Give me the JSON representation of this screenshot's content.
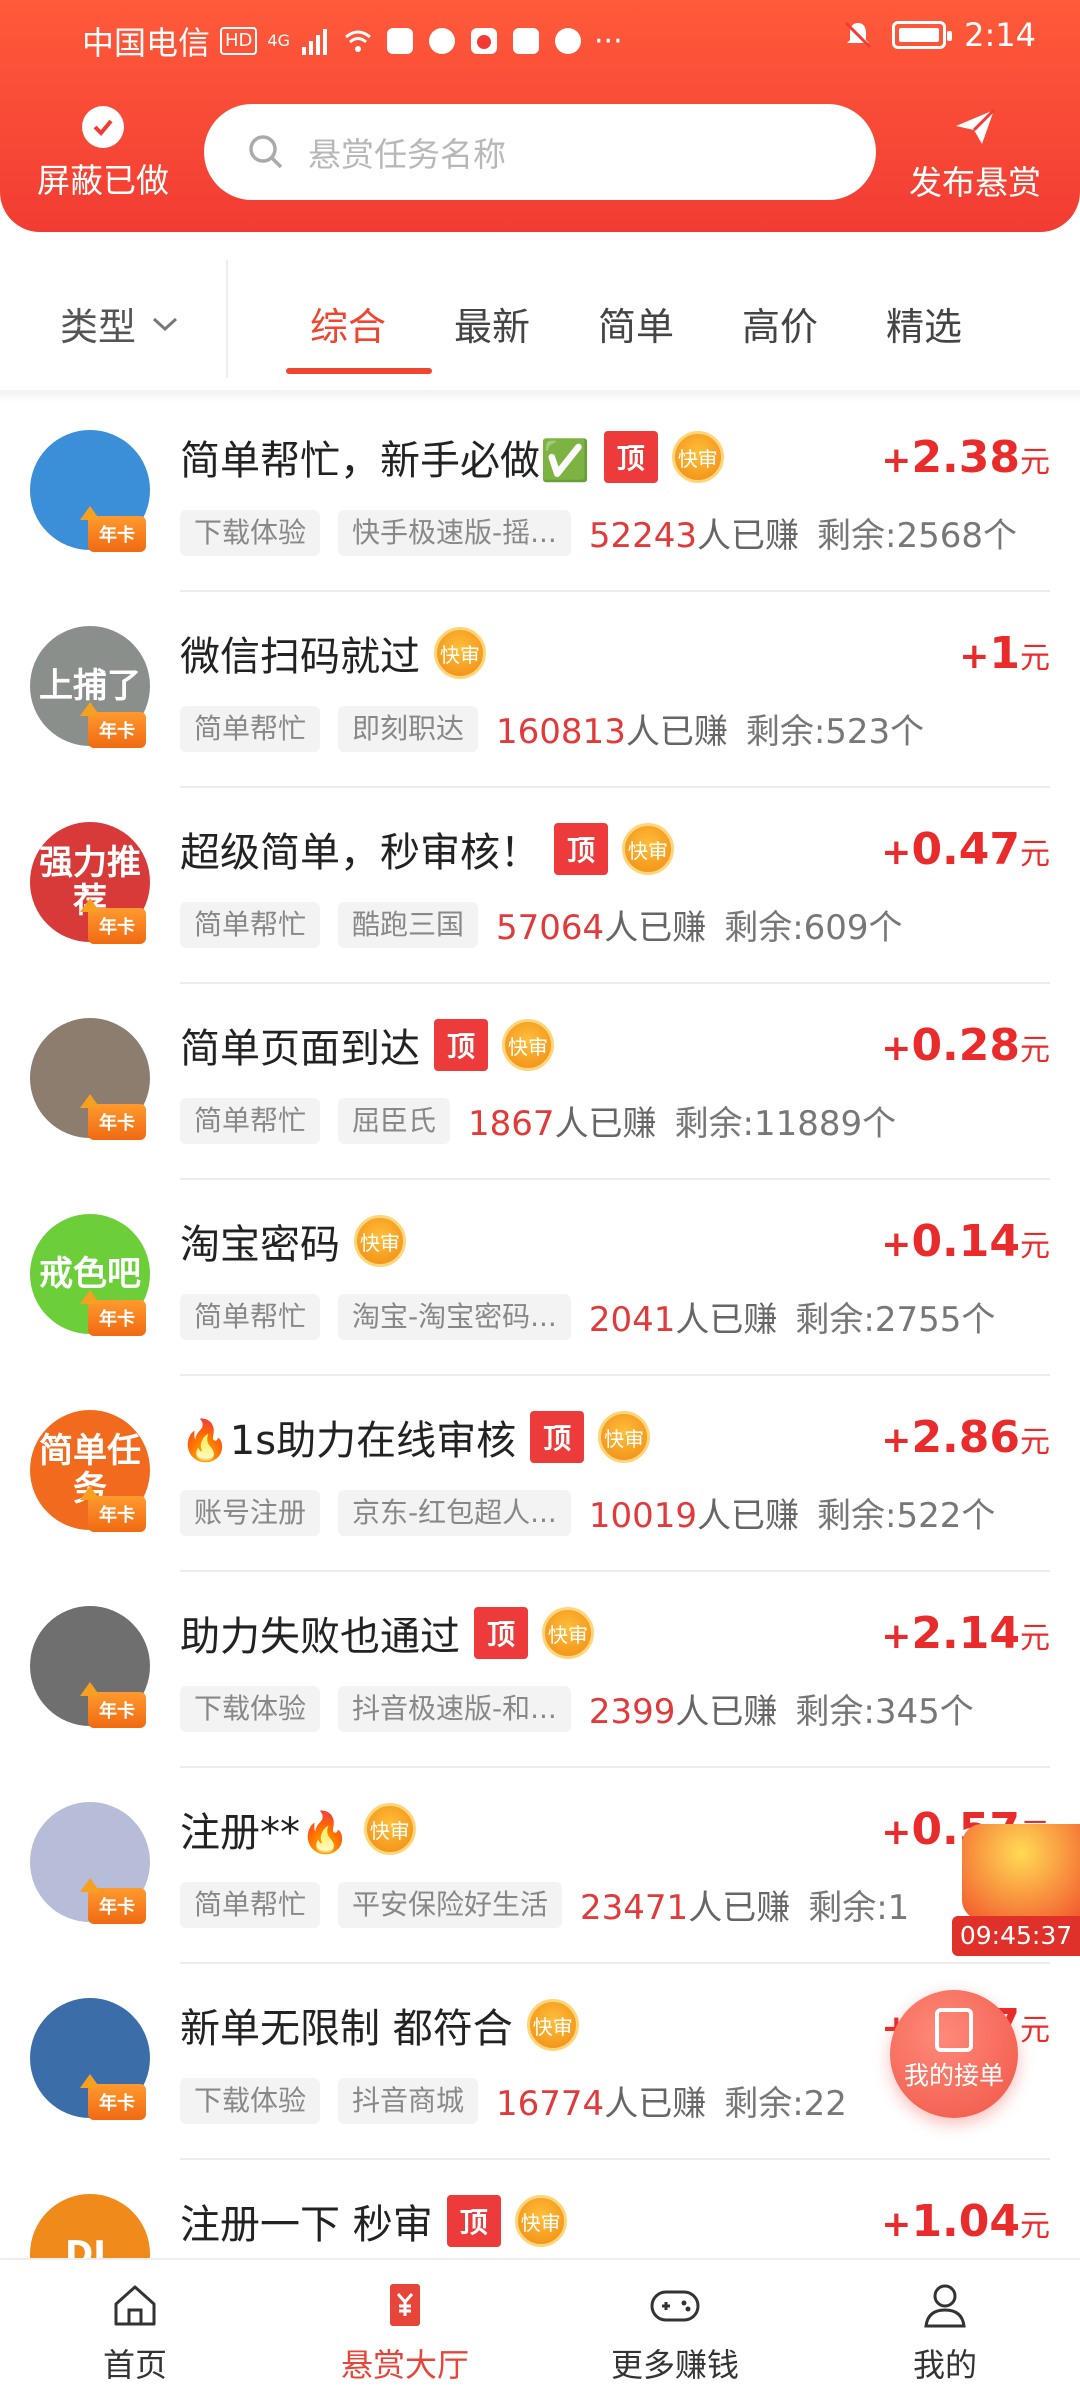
{
  "status_bar": {
    "carrier": "中国电信",
    "hd": "HD",
    "network": "4G",
    "time": "2:14",
    "more": "···"
  },
  "header": {
    "hide_done_label": "屏蔽已做",
    "search_placeholder": "悬赏任务名称",
    "publish_label": "发布悬赏",
    "bg_color": "#f23c33"
  },
  "filter": {
    "type_label": "类型",
    "tabs": [
      "综合",
      "最新",
      "简单",
      "高价",
      "精选"
    ],
    "active_tab": "综合",
    "accent_color": "#f0452f"
  },
  "badges": {
    "top": "顶",
    "fast": "快审",
    "year_card": "年卡"
  },
  "tasks": [
    {
      "title": "简单帮忙，新手必做✅",
      "top": true,
      "fast": true,
      "price": "2.38",
      "tag1": "下载体验",
      "tag2": "快手极速版-摇...",
      "earned": "52243",
      "earned_suffix": "人已赚",
      "remaining": "剩余:2568个",
      "avatar_text": "",
      "avatar_color": "#3b8fd9"
    },
    {
      "title": "微信扫码就过",
      "top": false,
      "fast": true,
      "price": "1",
      "tag1": "简单帮忙",
      "tag2": "即刻职达",
      "earned": "160813",
      "earned_suffix": "人已赚",
      "remaining": "剩余:523个",
      "avatar_text": "上捕了",
      "avatar_color": "#8a8f8c"
    },
    {
      "title": "超级简单，秒审核！",
      "top": true,
      "fast": true,
      "price": "0.47",
      "tag1": "简单帮忙",
      "tag2": "酷跑三国",
      "earned": "57064",
      "earned_suffix": "人已赚",
      "remaining": "剩余:609个",
      "avatar_text": "强力推荐",
      "avatar_color": "#d83a3a"
    },
    {
      "title": "简单页面到达",
      "top": true,
      "fast": true,
      "price": "0.28",
      "tag1": "简单帮忙",
      "tag2": "屈臣氏",
      "earned": "1867",
      "earned_suffix": "人已赚",
      "remaining": "剩余:11889个",
      "avatar_text": "",
      "avatar_color": "#8d7d6e"
    },
    {
      "title": "淘宝密码",
      "top": false,
      "fast": true,
      "price": "0.14",
      "tag1": "简单帮忙",
      "tag2": "淘宝-淘宝密码...",
      "earned": "2041",
      "earned_suffix": "人已赚",
      "remaining": "剩余:2755个",
      "avatar_text": "戒色吧",
      "avatar_color": "#6ccf3a"
    },
    {
      "title": "🔥1s助力在线审核",
      "top": true,
      "fast": true,
      "price": "2.86",
      "tag1": "账号注册",
      "tag2": "京东-红包超人...",
      "earned": "10019",
      "earned_suffix": "人已赚",
      "remaining": "剩余:522个",
      "avatar_text": "简单任务",
      "avatar_color": "#f26a1d"
    },
    {
      "title": "助力失败也通过",
      "top": true,
      "fast": true,
      "price": "2.14",
      "tag1": "下载体验",
      "tag2": "抖音极速版-和...",
      "earned": "2399",
      "earned_suffix": "人已赚",
      "remaining": "剩余:345个",
      "avatar_text": "",
      "avatar_color": "#6f6f6f"
    },
    {
      "title": "注册**🔥",
      "top": false,
      "fast": true,
      "price": "0.57",
      "tag1": "简单帮忙",
      "tag2": "平安保险好生活",
      "earned": "23471",
      "earned_suffix": "人已赚",
      "remaining": "剩余:1",
      "avatar_text": "",
      "avatar_color": "#b7bcd9"
    },
    {
      "title": "新单无限制 都符合",
      "top": false,
      "fast": true,
      "price": "2.07",
      "tag1": "下载体验",
      "tag2": "抖音商城",
      "earned": "16774",
      "earned_suffix": "人已赚",
      "remaining": "剩余:22",
      "avatar_text": "",
      "avatar_color": "#3b6ea8"
    },
    {
      "title": "注册一下 秒审",
      "top": true,
      "fast": true,
      "price": "1.04",
      "tag1": "",
      "tag2": "",
      "earned": "",
      "earned_suffix": "",
      "remaining": "",
      "avatar_text": "DL",
      "avatar_color": "#f08a1a"
    }
  ],
  "price_plus": "+",
  "price_unit": "元",
  "floating": {
    "gift_timer": "09:45:37",
    "my_orders_label": "我的接单"
  },
  "bottom_nav": {
    "items": [
      {
        "label": "首页",
        "icon": "home-icon"
      },
      {
        "label": "悬赏大厅",
        "icon": "reward-hall-icon"
      },
      {
        "label": "更多赚钱",
        "icon": "gamepad-icon"
      },
      {
        "label": "我的",
        "icon": "profile-icon"
      }
    ],
    "active": "悬赏大厅",
    "active_color": "#e8453a"
  }
}
